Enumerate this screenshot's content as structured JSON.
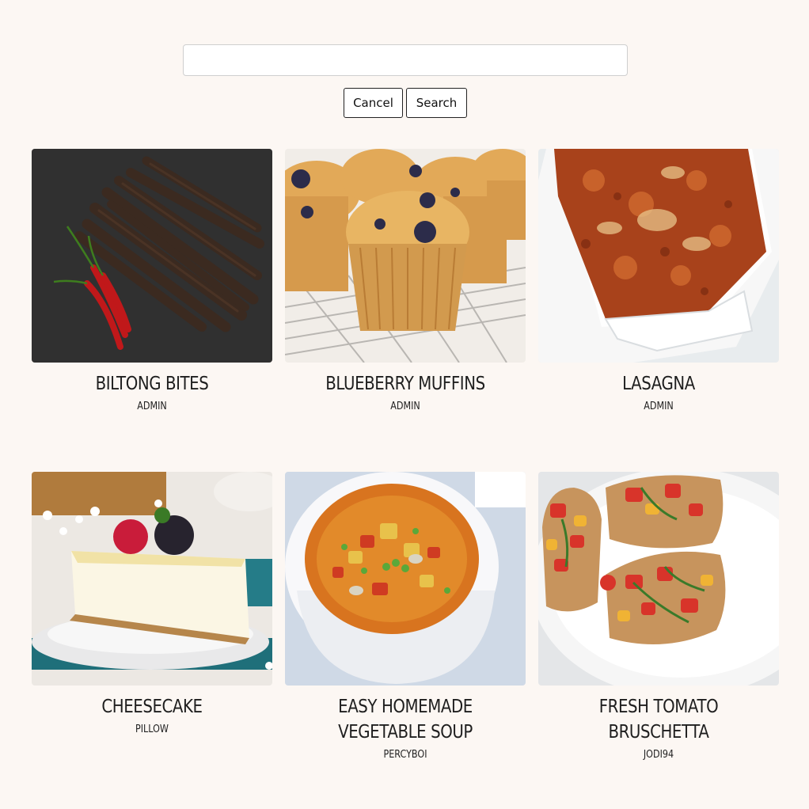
{
  "search": {
    "value": "",
    "placeholder": "",
    "cancel_label": "Cancel",
    "search_label": "Search"
  },
  "recipes": [
    {
      "title": "BILTONG BITES",
      "author": "ADMIN",
      "image": "biltong-photo"
    },
    {
      "title": "BLUEBERRY MUFFINS",
      "author": "ADMIN",
      "image": "muffin-photo"
    },
    {
      "title": "LASAGNA",
      "author": "ADMIN",
      "image": "lasagna-photo"
    },
    {
      "title": "CHEESECAKE",
      "author": "PILLOW",
      "image": "cheesecake-photo"
    },
    {
      "title": "EASY HOMEMADE VEGETABLE SOUP",
      "author": "PERCYBOI",
      "image": "soup-photo"
    },
    {
      "title": "FRESH TOMATO BRUSCHETTA",
      "author": "JODI94",
      "image": "bruschetta-photo"
    }
  ]
}
